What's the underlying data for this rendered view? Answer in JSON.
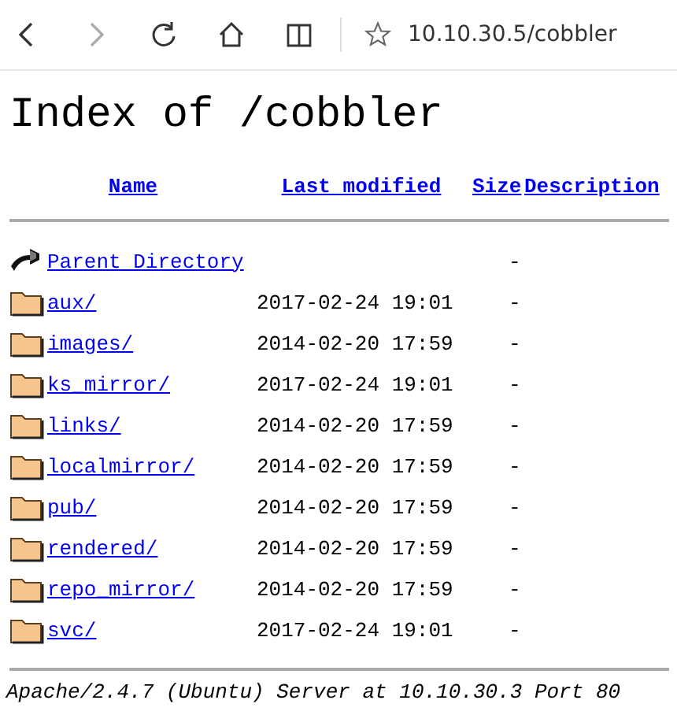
{
  "toolbar": {
    "buttons": [
      {
        "kind": "back",
        "disabled": false
      },
      {
        "kind": "forward",
        "disabled": true
      },
      {
        "kind": "refresh",
        "disabled": false
      },
      {
        "kind": "home",
        "disabled": false
      },
      {
        "kind": "reading",
        "disabled": false
      }
    ],
    "address": "10.10.30.5/cobbler"
  },
  "title": "Index of /cobbler",
  "columns": [
    "Name",
    "Last modified",
    "Size",
    "Description"
  ],
  "rows": [
    {
      "kind": "parent",
      "name": "Parent Directory",
      "modified": "",
      "size": "-"
    },
    {
      "kind": "folder",
      "name": "aux/",
      "modified": "2017-02-24 19:01",
      "size": "-"
    },
    {
      "kind": "folder",
      "name": "images/",
      "modified": "2014-02-20 17:59",
      "size": "-"
    },
    {
      "kind": "folder",
      "name": "ks_mirror/",
      "modified": "2017-02-24 19:01",
      "size": "-"
    },
    {
      "kind": "folder",
      "name": "links/",
      "modified": "2014-02-20 17:59",
      "size": "-"
    },
    {
      "kind": "folder",
      "name": "localmirror/",
      "modified": "2014-02-20 17:59",
      "size": "-"
    },
    {
      "kind": "folder",
      "name": "pub/",
      "modified": "2014-02-20 17:59",
      "size": "-"
    },
    {
      "kind": "folder",
      "name": "rendered/",
      "modified": "2014-02-20 17:59",
      "size": "-"
    },
    {
      "kind": "folder",
      "name": "repo_mirror/",
      "modified": "2014-02-20 17:59",
      "size": "-"
    },
    {
      "kind": "folder",
      "name": "svc/",
      "modified": "2017-02-24 19:01",
      "size": "-"
    }
  ],
  "footer": "Apache/2.4.7 (Ubuntu) Server at 10.10.30.3 Port 80"
}
